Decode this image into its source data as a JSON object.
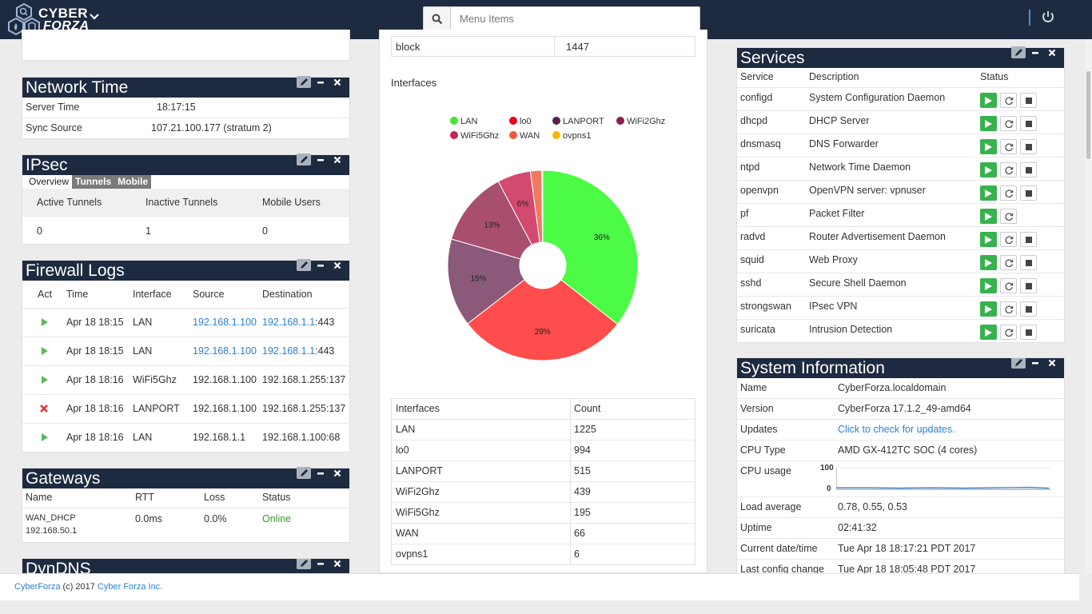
{
  "nav": {
    "brand_line1": "CYBER",
    "brand_line2": "FORZA",
    "search_placeholder": "Menu Items"
  },
  "left": {
    "network_time": {
      "title": "Network Time",
      "rows": [
        {
          "label": "Server Time",
          "value": "18:17:15"
        },
        {
          "label": "Sync Source",
          "value": "107.21.100.177 (stratum 2)"
        }
      ]
    },
    "ipsec": {
      "title": "IPsec",
      "tabs": [
        "Overview",
        "Tunnels",
        "Mobile"
      ],
      "headers": [
        "Active Tunnels",
        "Inactive Tunnels",
        "Mobile Users"
      ],
      "values": [
        "0",
        "1",
        "0"
      ]
    },
    "firewall_logs": {
      "title": "Firewall Logs",
      "headers": [
        "Act",
        "Time",
        "Interface",
        "Source",
        "Destination"
      ],
      "rows": [
        {
          "act": "pass",
          "time": "Apr 18 18:15",
          "iface": "LAN",
          "src": "192.168.1.100",
          "dst_link": "192.168.1.1",
          "dst_rest": ":443",
          "linked": true
        },
        {
          "act": "pass",
          "time": "Apr 18 18:15",
          "iface": "LAN",
          "src": "192.168.1.100",
          "dst_link": "192.168.1.1",
          "dst_rest": ":443",
          "linked": true
        },
        {
          "act": "pass",
          "time": "Apr 18 18:16",
          "iface": "WiFi5Ghz",
          "src": "192.168.1.100",
          "dst_link": "",
          "dst_rest": "192.168.1.255:137",
          "linked": false
        },
        {
          "act": "block",
          "time": "Apr 18 18:16",
          "iface": "LANPORT",
          "src": "192.168.1.100",
          "dst_link": "",
          "dst_rest": "192.168.1.255:137",
          "linked": false
        },
        {
          "act": "pass",
          "time": "Apr 18 18:16",
          "iface": "LAN",
          "src": "192.168.1.1",
          "dst_link": "",
          "dst_rest": "192.168.1.100:68",
          "linked": false
        }
      ]
    },
    "gateways": {
      "title": "Gateways",
      "headers": [
        "Name",
        "RTT",
        "Loss",
        "Status"
      ],
      "row": {
        "name": "WAN_DHCP",
        "ip": "192.168.50.1",
        "rtt": "0.0ms",
        "loss": "0.0%",
        "status": "Online"
      }
    },
    "dyndns": {
      "title": "DynDNS"
    }
  },
  "middle": {
    "top_row": {
      "label": "block",
      "value": "1447"
    },
    "interfaces_title": "Interfaces",
    "table_headers": [
      "Interfaces",
      "Count"
    ]
  },
  "chart_data": {
    "type": "pie",
    "title": "Interfaces",
    "legend_position": "top",
    "categories": [
      "LAN",
      "lo0",
      "LANPORT",
      "WiFi2Ghz",
      "WiFi5Ghz",
      "WAN",
      "ovpns1"
    ],
    "values": [
      1225,
      994,
      515,
      439,
      195,
      66,
      6
    ],
    "slice_order": [
      "LAN",
      "lo0",
      "LANPORT",
      "WiFi2Ghz",
      "WiFi5Ghz",
      "WAN",
      "ovpns1"
    ],
    "legend_colors": [
      "#45e532",
      "#e8001c",
      "#5a1e4f",
      "#8a1d4e",
      "#c0235a",
      "#f25a3c",
      "#f5b800"
    ],
    "slice_colors": [
      "#4cfb45",
      "#ff4c4c",
      "#8b5a7a",
      "#a84f6f",
      "#d24a70",
      "#f07a5e",
      "#e0d0a0"
    ],
    "percent_labels": [
      "36%",
      "29%",
      "15%",
      "13%",
      "6%",
      "",
      ""
    ],
    "donut": true
  },
  "right": {
    "services": {
      "title": "Services",
      "headers": [
        "Service",
        "Description",
        "Status"
      ],
      "rows": [
        {
          "name": "configd",
          "desc": "System Configuration Daemon",
          "stop": true
        },
        {
          "name": "dhcpd",
          "desc": "DHCP Server",
          "stop": true
        },
        {
          "name": "dnsmasq",
          "desc": "DNS Forwarder",
          "stop": true
        },
        {
          "name": "ntpd",
          "desc": "Network Time Daemon",
          "stop": true
        },
        {
          "name": "openvpn",
          "desc": "OpenVPN server: vpnuser",
          "stop": true
        },
        {
          "name": "pf",
          "desc": "Packet Filter",
          "stop": false
        },
        {
          "name": "radvd",
          "desc": "Router Advertisement Daemon",
          "stop": true
        },
        {
          "name": "squid",
          "desc": "Web Proxy",
          "stop": true
        },
        {
          "name": "sshd",
          "desc": "Secure Shell Daemon",
          "stop": true
        },
        {
          "name": "strongswan",
          "desc": "IPsec VPN",
          "stop": true
        },
        {
          "name": "suricata",
          "desc": "Intrusion Detection",
          "stop": true
        }
      ]
    },
    "sysinfo": {
      "title": "System Information",
      "rows": [
        {
          "label": "Name",
          "value": "CyberForza.localdomain"
        },
        {
          "label": "Version",
          "value": "CyberForza 17.1.2_49-amd64"
        },
        {
          "label": "Updates",
          "value": "Click to check for updates."
        },
        {
          "label": "CPU Type",
          "value": "AMD GX-412TC SOC (4 cores)"
        },
        {
          "label": "CPU usage",
          "value": ""
        },
        {
          "label": "Load average",
          "value": "0.78, 0.55, 0.53"
        },
        {
          "label": "Uptime",
          "value": "02:41:32"
        },
        {
          "label": "Current date/time",
          "value": "Tue Apr 18 18:17:21 PDT 2017"
        },
        {
          "label": "Last config change",
          "value": "Tue Apr 18 18:05:48 PDT 2017"
        }
      ],
      "cpu_axis": [
        "100",
        "0"
      ]
    }
  },
  "footer": {
    "product": "CyberForza",
    "copy": " (c) 2017 ",
    "company": "Cyber Forza Inc."
  }
}
